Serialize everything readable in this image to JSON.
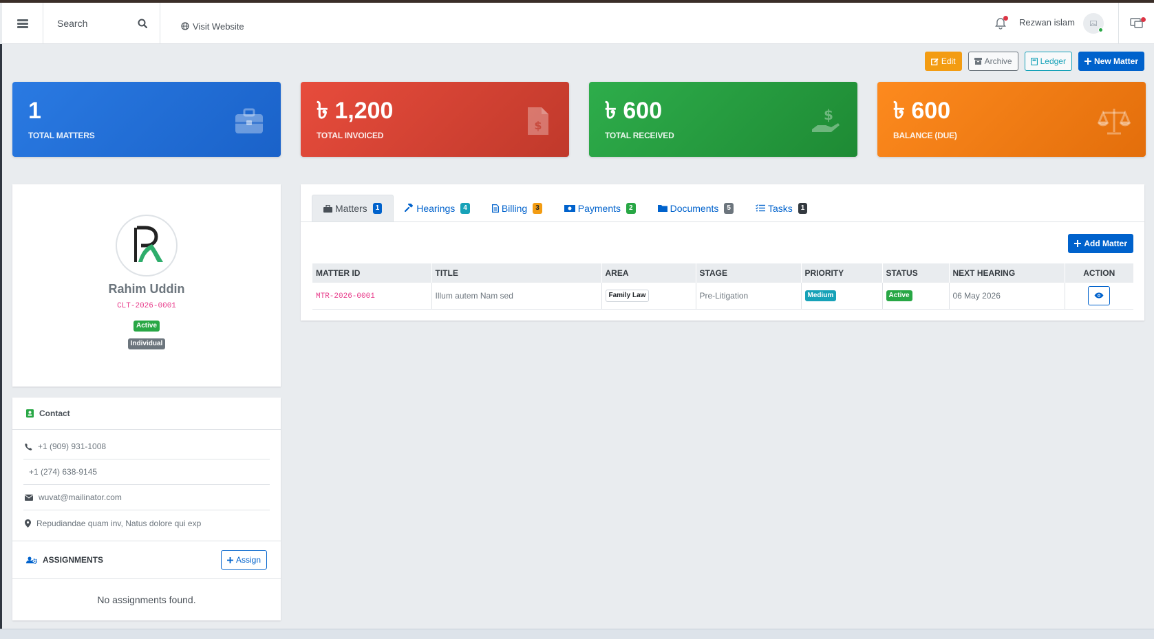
{
  "navbar": {
    "search_placeholder": "Search",
    "visit_website": "Visit Website",
    "user_name": "Rezwan islam"
  },
  "actions": {
    "edit": "Edit",
    "archive": "Archive",
    "ledger": "Ledger",
    "new_matter": "New Matter"
  },
  "stats": [
    {
      "value": "1",
      "label": "TOTAL MATTERS",
      "icon": "briefcase-icon"
    },
    {
      "value": "৳ 1,200",
      "label": "TOTAL INVOICED",
      "icon": "invoice-icon"
    },
    {
      "value": "৳ 600",
      "label": "TOTAL RECEIVED",
      "icon": "hand-dollar-icon"
    },
    {
      "value": "৳ 600",
      "label": "BALANCE (DUE)",
      "icon": "balance-scale-icon"
    }
  ],
  "client": {
    "name": "Rahim Uddin",
    "code": "CLT-2026-0001",
    "status": "Active",
    "type": "Individual"
  },
  "contact": {
    "title": "Contact",
    "phone1": "+1 (909) 931-1008",
    "phone2": "+1 (274) 638-9145",
    "email": "wuvat@mailinator.com",
    "address": "Repudiandae quam inv, Natus dolore qui exp"
  },
  "assignments": {
    "title": "ASSIGNMENTS",
    "assign_button": "Assign",
    "empty": "No assignments found."
  },
  "tabs": [
    {
      "label": "Matters",
      "count": "1"
    },
    {
      "label": "Hearings",
      "count": "4"
    },
    {
      "label": "Billing",
      "count": "3"
    },
    {
      "label": "Payments",
      "count": "2"
    },
    {
      "label": "Documents",
      "count": "5"
    },
    {
      "label": "Tasks",
      "count": "1"
    }
  ],
  "matters": {
    "add_button": "Add Matter",
    "columns": [
      "MATTER ID",
      "TITLE",
      "AREA",
      "STAGE",
      "PRIORITY",
      "STATUS",
      "NEXT HEARING",
      "ACTION"
    ],
    "rows": [
      {
        "id": "MTR-2026-0001",
        "title": "Illum autem Nam sed",
        "area": "Family Law",
        "stage": "Pre-Litigation",
        "priority": "Medium",
        "status": "Active",
        "next_hearing": "06 May 2026"
      }
    ]
  },
  "colors": {
    "primary": "#0062cc",
    "blue_card": "#2a7ae2",
    "red_card": "#e74c3c",
    "green_card": "#2ead4b",
    "orange_card": "#fd8a1e"
  }
}
